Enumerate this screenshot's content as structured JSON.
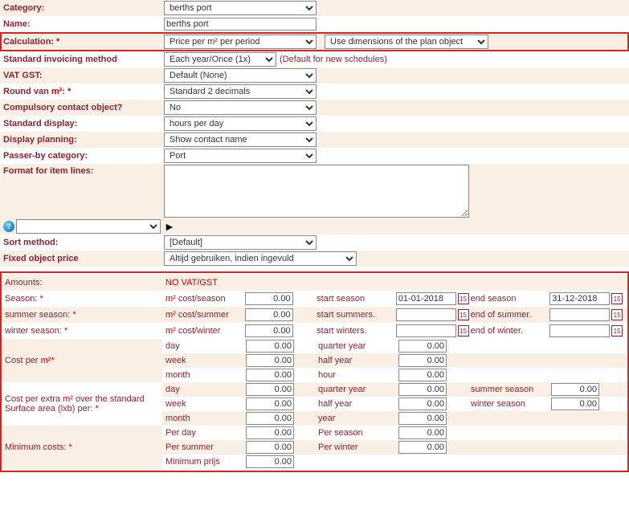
{
  "fields": {
    "category": {
      "label": "Category:",
      "value": "berths port"
    },
    "name": {
      "label": "Name:",
      "value": "berths port"
    },
    "calculation": {
      "label": "Calculation:",
      "value1": "Price per m² per period",
      "value2": "Use dimensions of the plan object"
    },
    "invoicing": {
      "label": "Standard invoicing method",
      "value": "Each year/Once (1x)",
      "note": "(Default for new schedules)"
    },
    "vat": {
      "label": "VAT GST:",
      "value": "Default (None)"
    },
    "round": {
      "label_pre": "Round van ",
      "label_unit": "m²",
      "label_post": ":",
      "value": "Standard 2 decimals"
    },
    "compulsory": {
      "label": "Compulsory contact object?",
      "value": "No"
    },
    "stddisplay": {
      "label": "Standard display:",
      "value": "hours per day"
    },
    "displayplan": {
      "label": "Display planning:",
      "value": "Show contact name"
    },
    "passerby": {
      "label": "Passer-by category:",
      "value": "Port"
    },
    "format": {
      "label": "Format for item lines:",
      "value": ""
    },
    "sort": {
      "label": "Sort method:",
      "value": "[Default]"
    },
    "fixed": {
      "label": "Fixed object price",
      "value": "Altijd gebruiken, indien ingevuld"
    }
  },
  "amounts": {
    "header": {
      "label": "Amounts:",
      "value": "NO VAT/GST"
    },
    "season": {
      "label": "Season:",
      "unit_pre": "m²",
      "unit_post": " cost/season",
      "cost": "0.00",
      "start_label": "start season",
      "start_val": "01-01-2018",
      "end_label": "end season",
      "end_val": "31-12-2018"
    },
    "summer": {
      "label": "summer season:",
      "unit_pre": "m²",
      "unit_post": " cost/summer",
      "cost": "0.00",
      "start_label": "start summers.",
      "start_val": "",
      "end_label": "end of summer.",
      "end_val": ""
    },
    "winter": {
      "label": "winter season:",
      "unit_pre": "m²",
      "unit_post": " cost/winter",
      "cost": "0.00",
      "start_label": "start winters.",
      "start_val": "",
      "end_label": "end of winter.",
      "end_val": ""
    },
    "cost_per_m2": {
      "label_pre": "Cost per ",
      "label_unit": "m²",
      "rows": [
        {
          "l1": "day",
          "v1": "0.00",
          "l2": "quarter year",
          "v2": "0.00"
        },
        {
          "l1": "week",
          "v1": "0.00",
          "l2": "half year",
          "v2": "0.00"
        },
        {
          "l1": "month",
          "v1": "0.00",
          "l2": "hour",
          "v2": "0.00"
        }
      ]
    },
    "cost_extra": {
      "label_pre": "Cost per extra ",
      "label_unit": "m²",
      "label_post": " over the standard Surface area (lxb) per:",
      "rows": [
        {
          "l1": "day",
          "v1": "0.00",
          "l2": "quarter year",
          "v2": "0.00",
          "l3": "summer season",
          "v3": "0.00"
        },
        {
          "l1": "week",
          "v1": "0.00",
          "l2": "half year",
          "v2": "0.00",
          "l3": "winter season",
          "v3": "0.00"
        },
        {
          "l1": "month",
          "v1": "0.00",
          "l2": "year",
          "v2": "0.00"
        }
      ]
    },
    "minimum": {
      "label": "Minimum costs:",
      "rows": [
        {
          "l1": "Per day",
          "v1": "0.00",
          "l2": "Per season",
          "v2": "0.00"
        },
        {
          "l1": "Per summer",
          "v1": "0.00",
          "l2": "Per winter",
          "v2": "0.00"
        },
        {
          "l1": "Minimum prijs",
          "v1": "0.00"
        }
      ]
    }
  },
  "icons": {
    "cal": "15",
    "help": "?",
    "arrow": "►"
  }
}
